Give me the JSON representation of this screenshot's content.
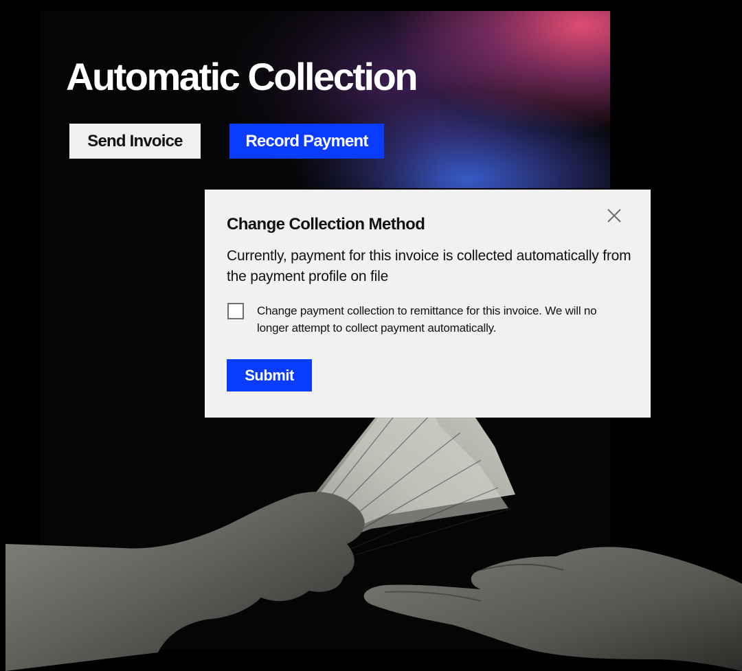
{
  "hero": {
    "title": "Automatic Collection",
    "send_invoice_label": "Send Invoice",
    "record_payment_label": "Record Payment"
  },
  "modal": {
    "title": "Change Collection Method",
    "description": "Currently, payment for this invoice is collected automatically from the payment profile on file",
    "checkbox_label": "Change payment collection to remittance for this invoice. We will no longer attempt to  collect payment automatically.",
    "checkbox_checked": false,
    "submit_label": "Submit",
    "close_icon": "close-icon"
  },
  "illustration": {
    "subject": "hand-passing-cash-to-open-hand"
  },
  "colors": {
    "background": "#000000",
    "accent_blue": "#0a3cff",
    "modal_bg": "#f1f1f1",
    "gradient_pink": "#ec5078",
    "gradient_blue": "#3c64dc"
  }
}
